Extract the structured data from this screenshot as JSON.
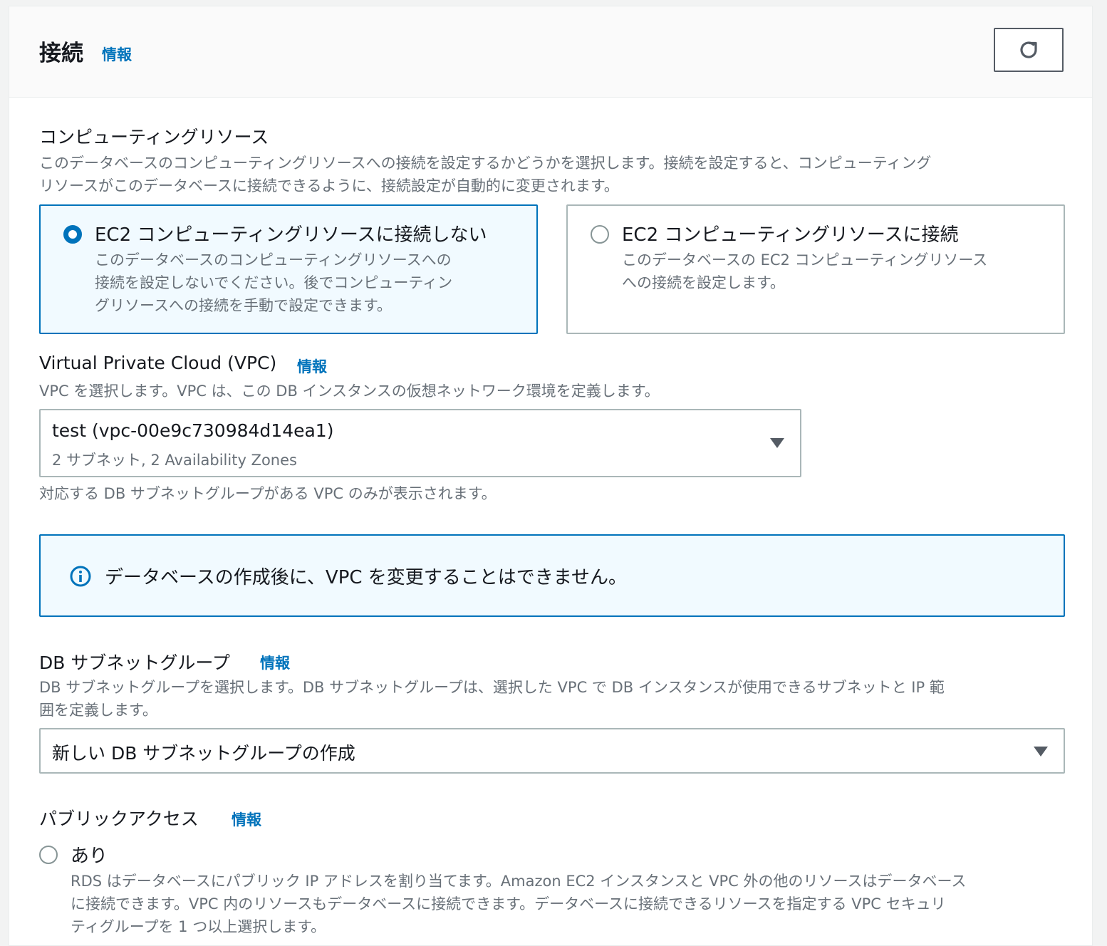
{
  "header": {
    "title": "接続",
    "info": "情報",
    "refresh_icon": "refresh-icon"
  },
  "compute": {
    "label": "コンピューティングリソース",
    "desc_line1": "このデータベースのコンピューティングリソースへの接続を設定するかどうかを選択します。接続を設定すると、コンピューティング",
    "desc_line2": "リソースがこのデータベースに接続できるように、接続設定が自動的に変更されます。",
    "options": [
      {
        "title": "EC2 コンピューティングリソースに接続しない",
        "desc_lines": [
          "このデータベースのコンピューティングリソースへの",
          "接続を設定しないでください。後でコンピューティン",
          "グリソースへの接続を手動で設定できます。"
        ],
        "selected": true
      },
      {
        "title": "EC2 コンピューティングリソースに接続",
        "desc_lines": [
          "このデータベースの EC2 コンピューティングリソース",
          "への接続を設定します。"
        ],
        "selected": false
      }
    ]
  },
  "vpc": {
    "label": "Virtual Private Cloud (VPC)",
    "info": "情報",
    "desc": "VPC を選択します。VPC は、この DB インスタンスの仮想ネットワーク環境を定義します。",
    "selected_value": "test (vpc-00e9c730984d14ea1)",
    "selected_sub": "2 サブネット, 2 Availability Zones",
    "hint": "対応する DB サブネットグループがある VPC のみが表示されます。"
  },
  "alert": {
    "icon": "info-icon",
    "text": "データベースの作成後に、VPC を変更することはできません。"
  },
  "subnet": {
    "label": "DB サブネットグループ",
    "info": "情報",
    "desc_line1": "DB サブネットグループを選択します。DB サブネットグループは、選択した VPC で DB インスタンスが使用できるサブネットと IP 範",
    "desc_line2": "囲を定義します。",
    "selected_value": "新しい DB サブネットグループの作成"
  },
  "public_access": {
    "label": "パブリックアクセス",
    "info": "情報",
    "option_yes": "あり",
    "yes_desc_lines": [
      "RDS はデータベースにパブリック IP アドレスを割り当てます。Amazon EC2 インスタンスと VPC 外の他のリソースはデータベース",
      "に接続できます。VPC 内のリソースもデータベースに接続できます。データベースに接続できるリソースを指定する VPC セキュリ",
      "ティグループを 1 つ以上選択します。"
    ]
  },
  "colors": {
    "accent": "#0073bb",
    "text": "#16191f",
    "muted": "#687078",
    "border": "#aab7b8",
    "selected_bg": "#f1faff"
  }
}
